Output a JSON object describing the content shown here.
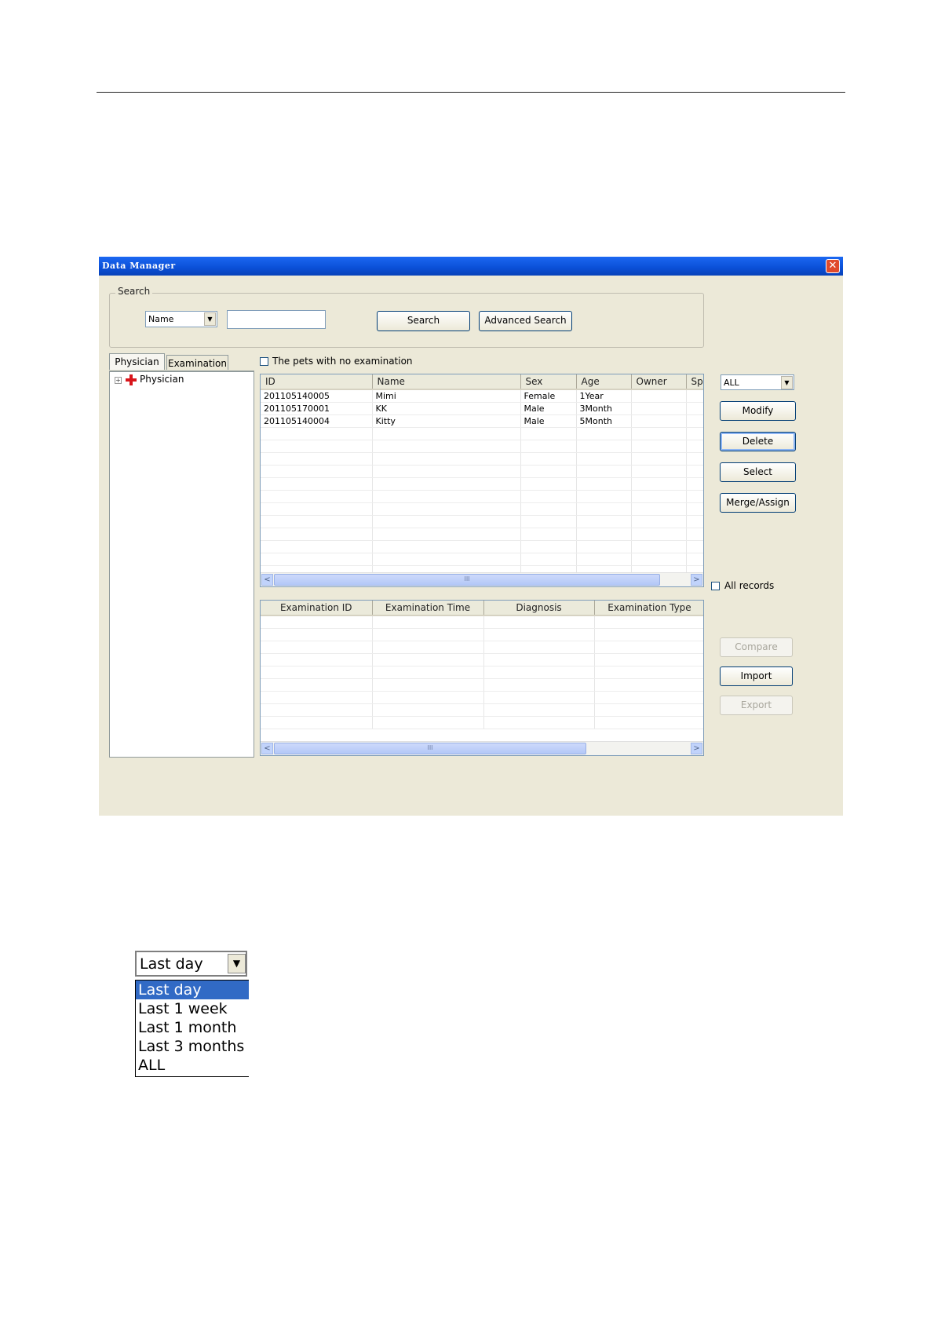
{
  "window": {
    "title": "Data Manager",
    "close_symbol": "✕"
  },
  "search": {
    "group_label": "Search",
    "field_select": "Name",
    "text_value": "",
    "search_button": "Search",
    "advanced_button": "Advanced Search"
  },
  "tabs": [
    "Physician",
    "Examination"
  ],
  "tree": {
    "root_label": "Physician",
    "expander": "+"
  },
  "no_exam_checkbox": {
    "label": "The pets with no examination",
    "checked": false
  },
  "patients": {
    "columns": [
      "ID",
      "Name",
      "Sex",
      "Age",
      "Owner",
      "Spe"
    ],
    "rows": [
      [
        "201105140005",
        "Mimi",
        "Female",
        "1Year",
        "",
        ""
      ],
      [
        "201105170001",
        "KK",
        "Male",
        "3Month",
        "",
        ""
      ],
      [
        "201105140004",
        "Kitty",
        "Male",
        "5Month",
        "",
        ""
      ]
    ],
    "empty_rows": 12
  },
  "filter_select": "ALL",
  "buttons": {
    "modify": "Modify",
    "delete": "Delete",
    "select": "Select",
    "merge": "Merge/Assign",
    "compare": "Compare",
    "import": "Import",
    "export": "Export"
  },
  "all_records": {
    "label": "All records",
    "checked": false
  },
  "examinations": {
    "columns": [
      "Examination ID",
      "Examination Time",
      "Diagnosis",
      "Examination Type"
    ],
    "empty_rows": 9
  },
  "scroll_symbols": {
    "left": "<",
    "right": ">",
    "grip": "III"
  },
  "dropdown_example": {
    "selected": "Last day",
    "options": [
      "Last day",
      "Last 1 week",
      "Last 1 month",
      "Last 3 months",
      "ALL"
    ]
  },
  "colors": {
    "titlebar": "#0a4fd6",
    "window_bg": "#ece9d8",
    "selection": "#316ac5"
  }
}
